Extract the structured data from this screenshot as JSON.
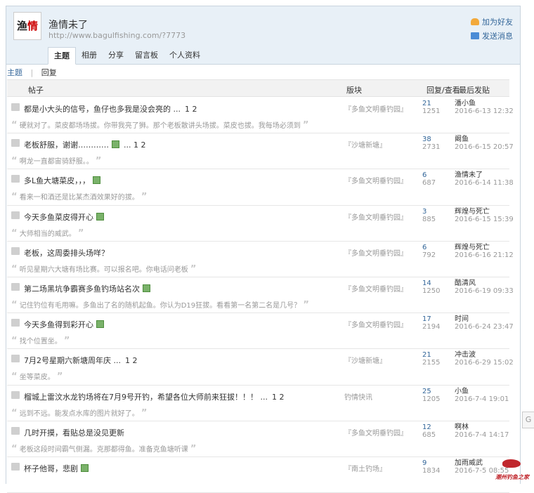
{
  "profile": {
    "avatar_chars": [
      "渔",
      "情"
    ],
    "name": "渔情未了",
    "url": "http://www.bagulfishing.com/?7773",
    "add_friend": "加为好友",
    "send_message": "发送消息"
  },
  "tabs": [
    "主题",
    "相册",
    "分享",
    "留言板",
    "个人资料"
  ],
  "subnav": {
    "topics": "主题",
    "sep": "|",
    "replies": "回复"
  },
  "table_headers": {
    "post": "帖子",
    "forum": "版块",
    "stats": "回复/查看",
    "last": "最后发贴"
  },
  "posts": [
    {
      "title": "都是小大头的信号，鱼仔也多我是没会亮的 ...",
      "pages": "1  2",
      "img": false,
      "excerpt": "硬就对了。菜皮都场场拔。你带我亮了狮。那个老板散讲头场拔。菜皮也拔。我每场必须到",
      "forum": "『多鱼文明垂钓园』",
      "replies": "21",
      "views": "1251",
      "last_user": "潘小鱼",
      "last_time": "2016-6-13 12:32"
    },
    {
      "title": "老板舒服，谢谢…………",
      "pages": "...  1  2",
      "img": true,
      "excerpt": "啊龙一直都宙骑舒服。。",
      "forum": "『沙塘新塘』",
      "replies": "38",
      "views": "2731",
      "last_user": "阚鱼",
      "last_time": "2016-6-15 20:57"
    },
    {
      "title": "多L鱼大塘菜皮，，，",
      "pages": "",
      "img": true,
      "excerpt": "看来一和酒还是比某杰酒效果好的拔。",
      "forum": "『多鱼文明垂钓园』",
      "replies": "6",
      "views": "687",
      "last_user": "渔情未了",
      "last_time": "2016-6-14 11:38"
    },
    {
      "title": "今天多鱼菜皮得开心",
      "pages": "",
      "img": true,
      "excerpt": "大师相当的威武。",
      "forum": "『多鱼文明垂钓园』",
      "replies": "3",
      "views": "885",
      "last_user": "辉煌与死亡",
      "last_time": "2016-6-15 15:39"
    },
    {
      "title": "老板，这周委排头场咩？",
      "pages": "",
      "img": false,
      "excerpt": "听见星期六大塘有场比赛。可以报名吧。你电话问老板",
      "forum": "『多鱼文明垂钓园』",
      "replies": "6",
      "views": "792",
      "last_user": "辉煌与死亡",
      "last_time": "2016-6-16 21:12"
    },
    {
      "title": "第二场黑坑争霸赛多鱼钓场站名次",
      "pages": "",
      "img": true,
      "excerpt": "记住钓位有毛用嘛。多鱼出了名的随机起鱼。你认为D19狂拔。看看第一名第二名是几号？",
      "forum": "『多鱼文明垂钓园』",
      "replies": "14",
      "views": "1250",
      "last_user": "酷清风",
      "last_time": "2016-6-19 09:33"
    },
    {
      "title": "今天多鱼得到彩开心",
      "pages": "",
      "img": true,
      "excerpt": "找个位置坐。",
      "forum": "『多鱼文明垂钓园』",
      "replies": "17",
      "views": "2194",
      "last_user": "时间",
      "last_time": "2016-6-24 23:47"
    },
    {
      "title": "7月2号星期六新塘周年庆 ...",
      "pages": "1  2",
      "img": false,
      "excerpt": "坐等菜皮。",
      "forum": "『沙塘新塘』",
      "replies": "21",
      "views": "2155",
      "last_user": "冲击波",
      "last_time": "2016-6-29 15:02"
    },
    {
      "title": "榴城上雷汶水龙钓场将在7月9号开钓，希望各位大师前来狂拔！！！ ...",
      "pages": "1  2",
      "img": false,
      "excerpt": "远到不远。能发点水库的图片就好了。",
      "forum": "钓情快讯",
      "replies": "25",
      "views": "1205",
      "last_user": "小鱼",
      "last_time": "2016-7-4 19:01"
    },
    {
      "title": "几时开摸，看贴总是没见更新",
      "pages": "",
      "img": false,
      "excerpt": "老板这段时间霸气侧漏。克那都得鱼。准备克鱼塘听课",
      "forum": "『多鱼文明垂钓园』",
      "replies": "12",
      "views": "685",
      "last_user": "啊林",
      "last_time": "2016-7-4 14:17"
    },
    {
      "title": "杯子他哥，悲剧",
      "pages": "",
      "img": true,
      "excerpt": "",
      "forum": "『南土钓场』",
      "replies": "9",
      "views": "1834",
      "last_user": "加雨威武",
      "last_time": "2016-7-5 08:55"
    }
  ],
  "side_button": "G",
  "watermark": "潮州钓鱼之家",
  "colors": {
    "link": "#336699",
    "header_bg": "#e8f0f7",
    "muted": "#999999"
  }
}
